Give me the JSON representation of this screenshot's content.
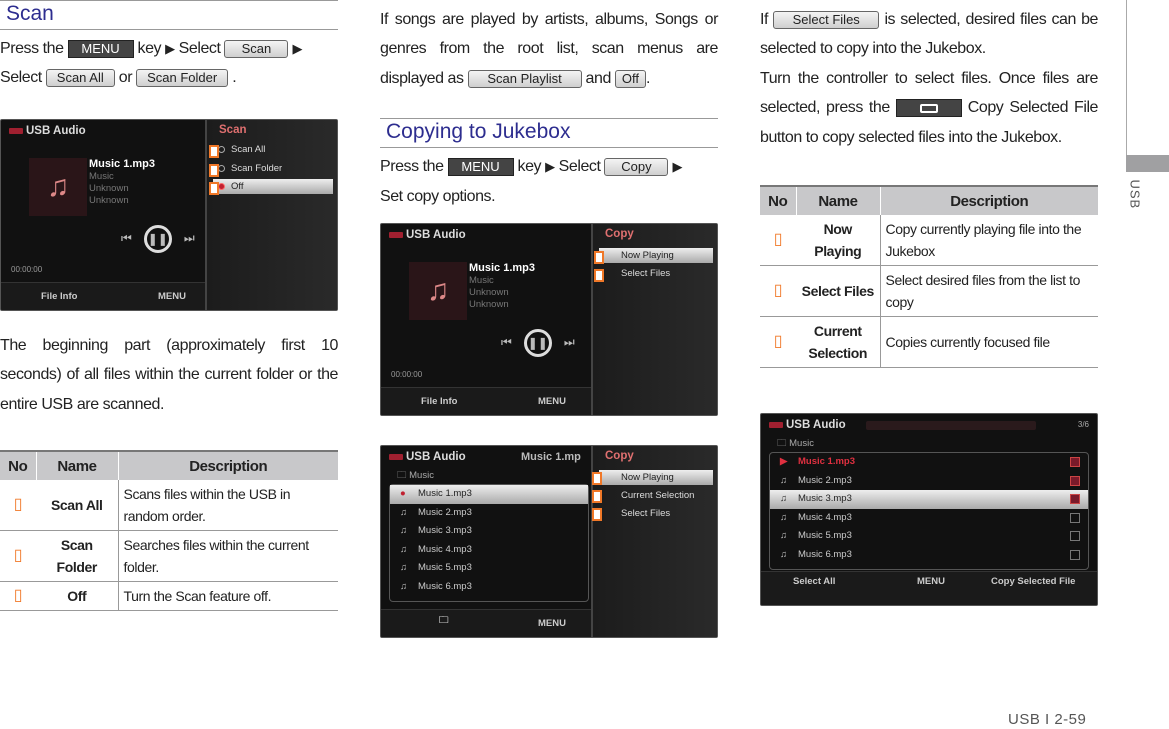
{
  "scan": {
    "title": "Scan",
    "l1_press": "Press the",
    "menu_key": "MENU",
    "l1_key": "key",
    "arrow": "▶",
    "l1_select": "Select",
    "scan_btn": "Scan",
    "l2_select": "Select",
    "scan_all_btn": "Scan All",
    "or": "or",
    "scan_folder_btn": "Scan Folder",
    "period": ".",
    "paragraph": "The beginning part (approximately first 10 seconds) of all files within the current folder or the entire USB are scanned.",
    "table": {
      "headers": [
        "No",
        "Name",
        "Description"
      ],
      "rows": [
        {
          "no": "",
          "name": "Scan All",
          "desc": "Scans files within the USB in random order."
        },
        {
          "no": "",
          "name": "Scan Folder",
          "desc": "Searches files within the current folder."
        },
        {
          "no": "",
          "name": "Off",
          "desc": "Turn the Scan feature off."
        }
      ]
    }
  },
  "screen_scan": {
    "header": "USB Audio",
    "panel_title": "Scan",
    "options": [
      "Scan All",
      "Scan Folder",
      "Off"
    ],
    "track": "Music 1.mp3",
    "folder": "Music",
    "artist": "Unknown",
    "album": "Unknown",
    "time": "00:00:00",
    "file_info": "File Info",
    "menu": "MENU"
  },
  "middle": {
    "paragraph_pre": "If songs are played by artists, albums, Songs or genres from the root list, scan menus are displayed as",
    "scan_playlist_btn": "Scan Playlist",
    "and": "and",
    "off_btn": "Off",
    "period": ".",
    "copy_title": "Copying to Jukebox",
    "press": "Press the",
    "menu_key": "MENU",
    "key": "key",
    "arrow": "▶",
    "select": "Select",
    "copy_btn": "Copy",
    "set_options": "Set copy options."
  },
  "screen_copy1": {
    "header": "USB Audio",
    "panel_title": "Copy",
    "options": [
      "Now Playing",
      "Select Files"
    ],
    "track": "Music 1.mp3",
    "folder": "Music",
    "artist": "Unknown",
    "album": "Unknown",
    "time": "00:00:00",
    "file_info": "File Info",
    "menu": "MENU"
  },
  "screen_copy2": {
    "header": "USB Audio",
    "now_title": "Music 1.mp",
    "panel_title": "Copy",
    "folder": "Music",
    "options": [
      "Now Playing",
      "Current Selection",
      "Select Files"
    ],
    "files": [
      "Music 1.mp3",
      "Music 2.mp3",
      "Music 3.mp3",
      "Music 4.mp3",
      "Music 5.mp3",
      "Music 6.mp3"
    ],
    "menu": "MENU"
  },
  "right": {
    "if": "If",
    "select_files_btn": "Select Files",
    "p1_rest": "is selected, desired files can be selected to copy into the Jukebox.",
    "p2_pre": "Turn the controller to select files. Once files are selected, press the",
    "p2_post": "Copy Selected File button to copy selected files into the Jukebox.",
    "table": {
      "headers": [
        "No",
        "Name",
        "Description"
      ],
      "rows": [
        {
          "no": "",
          "name": "Now Playing",
          "desc": "Copy currently playing file into the Jukebox"
        },
        {
          "no": "",
          "name": "Select Files",
          "desc": "Select desired files from the list to copy"
        },
        {
          "no": "",
          "name": "Current Selection",
          "desc": "Copies currently focused file"
        }
      ]
    }
  },
  "screen_select": {
    "header": "USB Audio",
    "page": "3/6",
    "folder": "Music",
    "files": [
      "Music 1.mp3",
      "Music 2.mp3",
      "Music 3.mp3",
      "Music 4.mp3",
      "Music 5.mp3",
      "Music 6.mp3"
    ],
    "checked": [
      true,
      true,
      true,
      false,
      false,
      false
    ],
    "select_all": "Select All",
    "menu": "MENU",
    "copy_selected": "Copy Selected File"
  },
  "side_tab": "USB",
  "footer": "USB I 2-59"
}
